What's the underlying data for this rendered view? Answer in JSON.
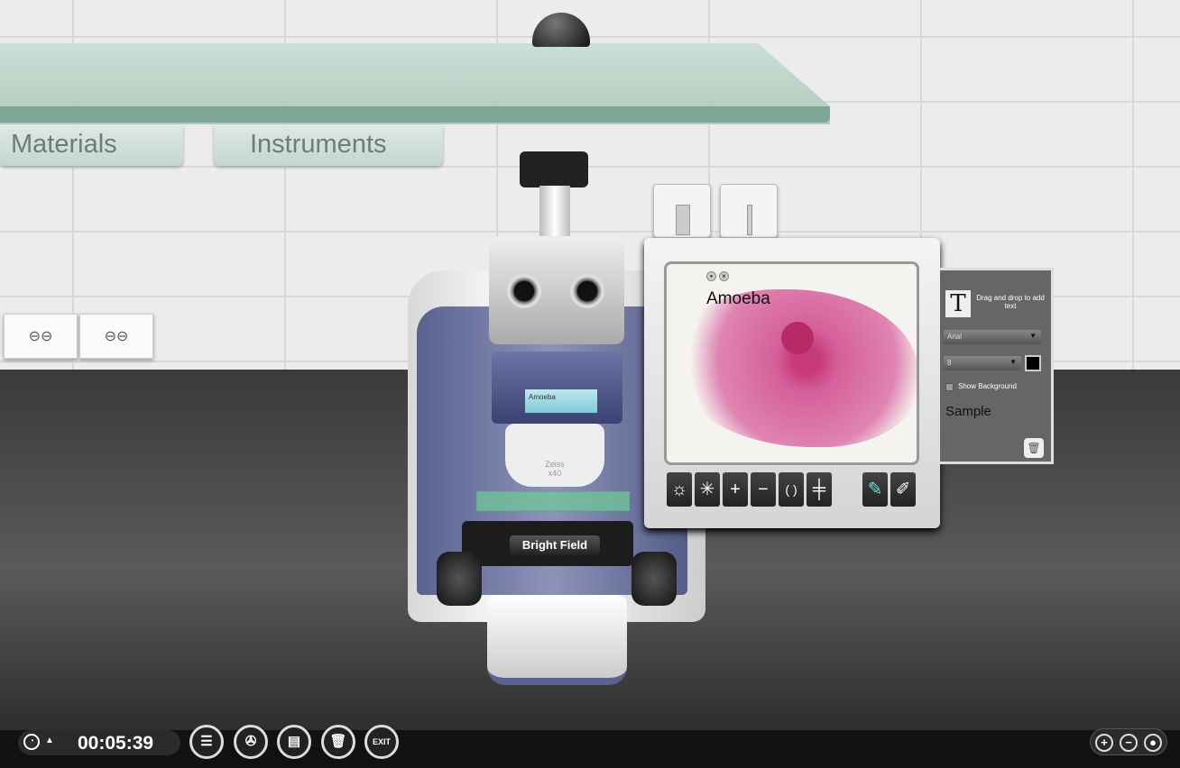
{
  "shelf": {
    "tabs": [
      "Materials",
      "Instruments"
    ]
  },
  "microscope": {
    "slide_label": "Amoeba",
    "objective_label": "Zeiss",
    "magnification": "x40",
    "mode_label": "Bright Field"
  },
  "viewer": {
    "annotation": "Amoeba",
    "toolbar": [
      {
        "icon": "brightness-icon",
        "glyph": "☼"
      },
      {
        "icon": "light-icon",
        "glyph": "✳"
      },
      {
        "icon": "zoom-in-icon",
        "glyph": "+"
      },
      {
        "icon": "zoom-out-icon",
        "glyph": "−"
      },
      {
        "icon": "focus-icon",
        "glyph": "( )"
      },
      {
        "icon": "scale-icon",
        "glyph": "╪"
      },
      {
        "icon": "annotate-icon",
        "glyph": "✎"
      },
      {
        "icon": "erase-icon",
        "glyph": "✐"
      }
    ]
  },
  "text_panel": {
    "hint": "Drag and drop to add text",
    "font": "Arial",
    "size": "8",
    "show_background_label": "Show Background",
    "sample": "Sample",
    "color": "#000000"
  },
  "bottom_bar": {
    "time": "00:05:39",
    "exit_label": "EXIT"
  }
}
